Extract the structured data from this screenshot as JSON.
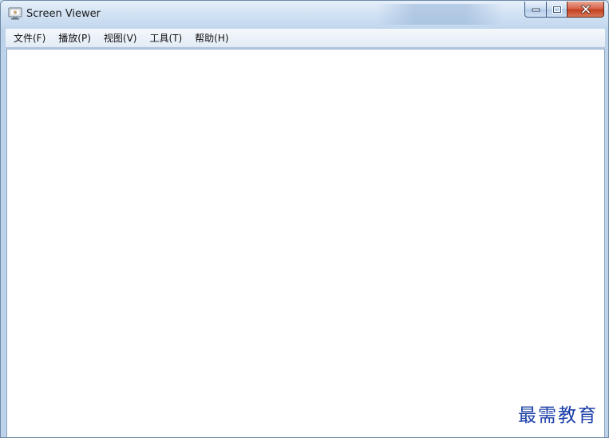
{
  "window": {
    "title": "Screen Viewer",
    "icon": "monitor-icon"
  },
  "controls": {
    "minimize_icon": "minimize-icon",
    "maximize_icon": "maximize-icon",
    "close_icon": "close-icon"
  },
  "menu": {
    "items": [
      {
        "label": "文件(F)"
      },
      {
        "label": "播放(P)"
      },
      {
        "label": "视图(V)"
      },
      {
        "label": "工具(T)"
      },
      {
        "label": "帮助(H)"
      }
    ]
  },
  "watermark": {
    "text": "最需教育"
  },
  "colors": {
    "watermark": "#1c3fa8",
    "close_button": "#c2401f",
    "client_background": "#ffffff"
  }
}
